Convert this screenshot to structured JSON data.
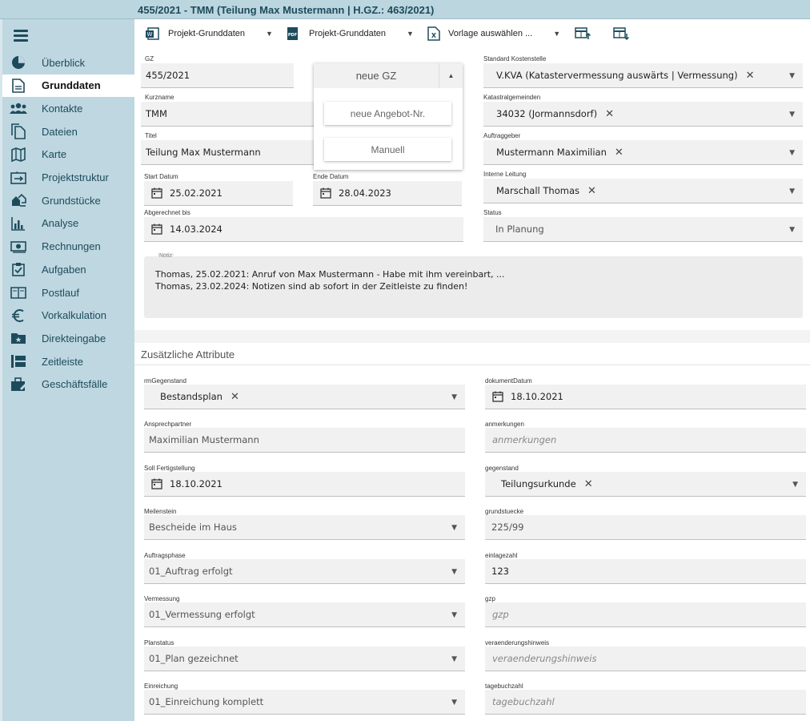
{
  "window": {
    "title": "455/2021 - TMM (Teilung Max Mustermann | H.GZ.: 463/2021)"
  },
  "sidebar": {
    "items": [
      {
        "label": "Überblick",
        "icon": "pie-chart-icon"
      },
      {
        "label": "Grunddaten",
        "icon": "document-icon"
      },
      {
        "label": "Kontakte",
        "icon": "people-icon"
      },
      {
        "label": "Dateien",
        "icon": "files-icon"
      },
      {
        "label": "Karte",
        "icon": "map-icon"
      },
      {
        "label": "Projektstruktur",
        "icon": "structure-icon"
      },
      {
        "label": "Grundstücke",
        "icon": "land-icon"
      },
      {
        "label": "Analyse",
        "icon": "analytics-icon"
      },
      {
        "label": "Rechnungen",
        "icon": "money-icon"
      },
      {
        "label": "Aufgaben",
        "icon": "task-icon"
      },
      {
        "label": "Postlauf",
        "icon": "mail-icon"
      },
      {
        "label": "Vorkalkulation",
        "icon": "euro-icon"
      },
      {
        "label": "Direkteingabe",
        "icon": "folder-star-icon"
      },
      {
        "label": "Zeitleiste",
        "icon": "timeline-icon"
      },
      {
        "label": "Geschäftsfälle",
        "icon": "briefcase-icon"
      }
    ]
  },
  "toolbar": {
    "word_template": "Projekt-Grunddaten",
    "pdf_template": "Projekt-Grunddaten",
    "excel_template": "Vorlage auswählen ..."
  },
  "form": {
    "gz": {
      "label": "GZ",
      "value": "455/2021"
    },
    "neue_gz": "neue GZ",
    "neue_angebot": "neue Angebot-Nr.",
    "manuell": "Manuell",
    "kurzname": {
      "label": "Kurzname",
      "value": "TMM"
    },
    "titel": {
      "label": "Titel",
      "value": "Teilung Max Mustermann"
    },
    "start": {
      "label": "Start Datum",
      "value": "25.02.2021"
    },
    "ende": {
      "label": "Ende Datum",
      "value": "28.04.2023"
    },
    "abgerechnet": {
      "label": "Abgerechnet bis",
      "value": "14.03.2024"
    },
    "kostenstelle": {
      "label": "Standard Kostenstelle",
      "value": "V.KVA (Katastervermessung auswärts | Vermessung)"
    },
    "katastral": {
      "label": "Katastralgemeinden",
      "value": "34032 (Jormannsdorf)"
    },
    "auftraggeber": {
      "label": "Auftraggeber",
      "value": "Mustermann Maximilian"
    },
    "leitung": {
      "label": "Interne Leitung",
      "value": "Marschall Thomas"
    },
    "status": {
      "label": "Status",
      "value": "In Planung"
    },
    "notiz": {
      "label": "Notiz",
      "lines": [
        "Thomas, 25.02.2021: Anruf von Max Mustermann - Habe mit ihm vereinbart, ...",
        "Thomas, 23.02.2024: Notizen sind ab sofort in der Zeitleiste zu finden!"
      ]
    }
  },
  "attributes": {
    "title": "Zusätzliche Attribute",
    "rmGegenstand": {
      "label": "rmGegenstand",
      "value": "Bestandsplan"
    },
    "dokumentDatum": {
      "label": "dokumentDatum",
      "value": "18.10.2021"
    },
    "ansprechpartner": {
      "label": "Ansprechpartner",
      "value": "Maximilian Mustermann"
    },
    "anmerkungen": {
      "label": "anmerkungen",
      "placeholder": "anmerkungen"
    },
    "soll": {
      "label": "Soll Fertigstellung",
      "value": "18.10.2021"
    },
    "gegenstand": {
      "label": "gegenstand",
      "value": "Teilungsurkunde"
    },
    "meilenstein": {
      "label": "Meilenstein",
      "value": "Bescheide im Haus"
    },
    "grundstuecke": {
      "label": "grundstuecke",
      "value": "225/99"
    },
    "auftragsphase": {
      "label": "Auftragsphase",
      "value": "01_Auftrag erfolgt"
    },
    "einlagezahl": {
      "label": "einlagezahl",
      "value": "123"
    },
    "vermessung": {
      "label": "Vermessung",
      "value": "01_Vermessung erfolgt"
    },
    "gzp": {
      "label": "gzp",
      "placeholder": "gzp"
    },
    "planstatus": {
      "label": "Planstatus",
      "value": "01_Plan gezeichnet"
    },
    "veraenderung": {
      "label": "veraenderungshinweis",
      "placeholder": "veraenderungshinweis"
    },
    "einreichung": {
      "label": "Einreichung",
      "value": "01_Einreichung komplett"
    },
    "tagebuchzahl": {
      "label": "tagebuchzahl",
      "placeholder": "tagebuchzahl"
    }
  }
}
